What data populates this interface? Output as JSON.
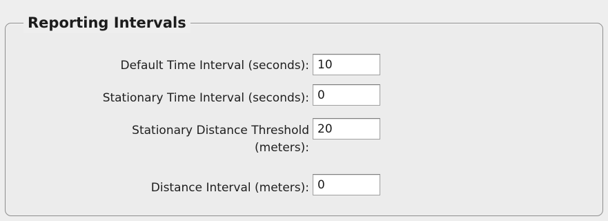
{
  "panel": {
    "legend": "Reporting Intervals"
  },
  "fields": [
    {
      "label": "Default Time Interval (seconds):",
      "value": "10"
    },
    {
      "label": "Stationary Time Interval (seconds):",
      "value": "0"
    },
    {
      "label_line1": "Stationary Distance Threshold",
      "label_line2": "(meters):",
      "value": "20"
    },
    {
      "label": "Distance Interval (meters):",
      "value": "0"
    }
  ]
}
